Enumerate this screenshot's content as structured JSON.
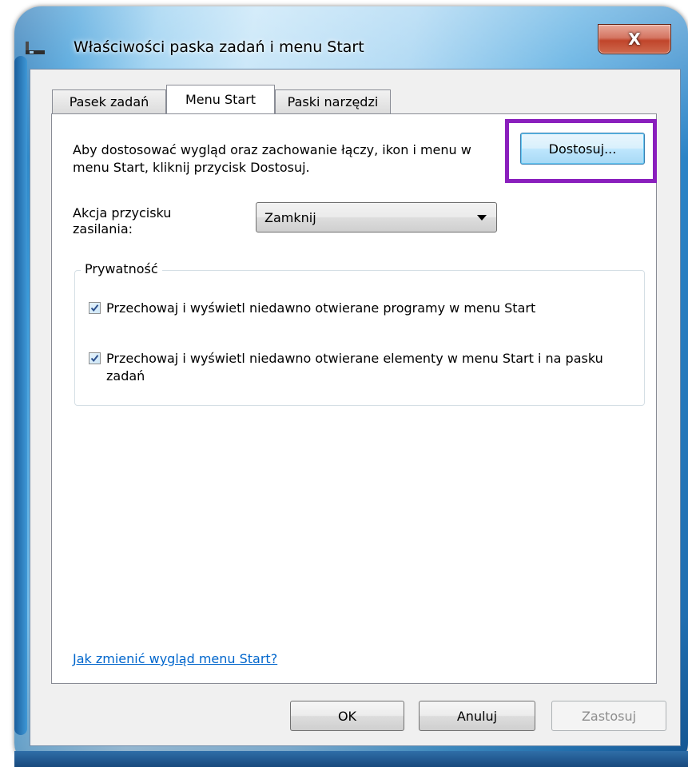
{
  "window": {
    "title": "Właściwości paska zadań i menu Start",
    "close_label": "X"
  },
  "tabs": [
    {
      "label": "Pasek zadań",
      "active": false
    },
    {
      "label": "Menu Start",
      "active": true
    },
    {
      "label": "Paski narzędzi",
      "active": false
    }
  ],
  "menu_start": {
    "description": "Aby dostosować wygląd oraz zachowanie łączy, ikon i menu w menu Start, kliknij przycisk Dostosuj.",
    "customize_label": "Dostosuj...",
    "power_label": "Akcja przycisku zasilania:",
    "power_value": "Zamknij",
    "privacy": {
      "title": "Prywatność",
      "items": [
        {
          "label": "Przechowaj i wyświetl niedawno otwierane programy w menu Start",
          "checked": true
        },
        {
          "label": "Przechowaj i wyświetl niedawno otwierane elementy w menu Start i na pasku zadań",
          "checked": true
        }
      ]
    },
    "help_link": "Jak zmienić wygląd menu Start?"
  },
  "footer": {
    "ok_label": "OK",
    "cancel_label": "Anuluj",
    "apply_label": "Zastosuj"
  },
  "colors": {
    "highlight_border": "#8a1fbd",
    "link": "#0066cc",
    "close_button": "#c0452b"
  }
}
